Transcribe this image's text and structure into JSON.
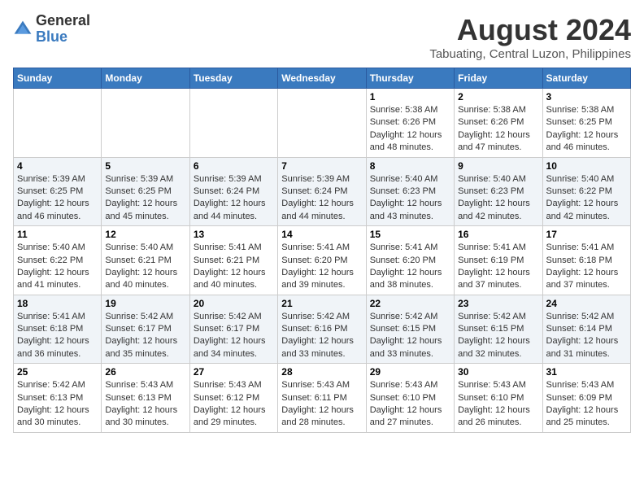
{
  "logo": {
    "general": "General",
    "blue": "Blue"
  },
  "title": {
    "month_year": "August 2024",
    "location": "Tabuating, Central Luzon, Philippines"
  },
  "days_of_week": [
    "Sunday",
    "Monday",
    "Tuesday",
    "Wednesday",
    "Thursday",
    "Friday",
    "Saturday"
  ],
  "weeks": [
    [
      {
        "day": "",
        "info": ""
      },
      {
        "day": "",
        "info": ""
      },
      {
        "day": "",
        "info": ""
      },
      {
        "day": "",
        "info": ""
      },
      {
        "day": "1",
        "info": "Sunrise: 5:38 AM\nSunset: 6:26 PM\nDaylight: 12 hours\nand 48 minutes."
      },
      {
        "day": "2",
        "info": "Sunrise: 5:38 AM\nSunset: 6:26 PM\nDaylight: 12 hours\nand 47 minutes."
      },
      {
        "day": "3",
        "info": "Sunrise: 5:38 AM\nSunset: 6:25 PM\nDaylight: 12 hours\nand 46 minutes."
      }
    ],
    [
      {
        "day": "4",
        "info": "Sunrise: 5:39 AM\nSunset: 6:25 PM\nDaylight: 12 hours\nand 46 minutes."
      },
      {
        "day": "5",
        "info": "Sunrise: 5:39 AM\nSunset: 6:25 PM\nDaylight: 12 hours\nand 45 minutes."
      },
      {
        "day": "6",
        "info": "Sunrise: 5:39 AM\nSunset: 6:24 PM\nDaylight: 12 hours\nand 44 minutes."
      },
      {
        "day": "7",
        "info": "Sunrise: 5:39 AM\nSunset: 6:24 PM\nDaylight: 12 hours\nand 44 minutes."
      },
      {
        "day": "8",
        "info": "Sunrise: 5:40 AM\nSunset: 6:23 PM\nDaylight: 12 hours\nand 43 minutes."
      },
      {
        "day": "9",
        "info": "Sunrise: 5:40 AM\nSunset: 6:23 PM\nDaylight: 12 hours\nand 42 minutes."
      },
      {
        "day": "10",
        "info": "Sunrise: 5:40 AM\nSunset: 6:22 PM\nDaylight: 12 hours\nand 42 minutes."
      }
    ],
    [
      {
        "day": "11",
        "info": "Sunrise: 5:40 AM\nSunset: 6:22 PM\nDaylight: 12 hours\nand 41 minutes."
      },
      {
        "day": "12",
        "info": "Sunrise: 5:40 AM\nSunset: 6:21 PM\nDaylight: 12 hours\nand 40 minutes."
      },
      {
        "day": "13",
        "info": "Sunrise: 5:41 AM\nSunset: 6:21 PM\nDaylight: 12 hours\nand 40 minutes."
      },
      {
        "day": "14",
        "info": "Sunrise: 5:41 AM\nSunset: 6:20 PM\nDaylight: 12 hours\nand 39 minutes."
      },
      {
        "day": "15",
        "info": "Sunrise: 5:41 AM\nSunset: 6:20 PM\nDaylight: 12 hours\nand 38 minutes."
      },
      {
        "day": "16",
        "info": "Sunrise: 5:41 AM\nSunset: 6:19 PM\nDaylight: 12 hours\nand 37 minutes."
      },
      {
        "day": "17",
        "info": "Sunrise: 5:41 AM\nSunset: 6:18 PM\nDaylight: 12 hours\nand 37 minutes."
      }
    ],
    [
      {
        "day": "18",
        "info": "Sunrise: 5:41 AM\nSunset: 6:18 PM\nDaylight: 12 hours\nand 36 minutes."
      },
      {
        "day": "19",
        "info": "Sunrise: 5:42 AM\nSunset: 6:17 PM\nDaylight: 12 hours\nand 35 minutes."
      },
      {
        "day": "20",
        "info": "Sunrise: 5:42 AM\nSunset: 6:17 PM\nDaylight: 12 hours\nand 34 minutes."
      },
      {
        "day": "21",
        "info": "Sunrise: 5:42 AM\nSunset: 6:16 PM\nDaylight: 12 hours\nand 33 minutes."
      },
      {
        "day": "22",
        "info": "Sunrise: 5:42 AM\nSunset: 6:15 PM\nDaylight: 12 hours\nand 33 minutes."
      },
      {
        "day": "23",
        "info": "Sunrise: 5:42 AM\nSunset: 6:15 PM\nDaylight: 12 hours\nand 32 minutes."
      },
      {
        "day": "24",
        "info": "Sunrise: 5:42 AM\nSunset: 6:14 PM\nDaylight: 12 hours\nand 31 minutes."
      }
    ],
    [
      {
        "day": "25",
        "info": "Sunrise: 5:42 AM\nSunset: 6:13 PM\nDaylight: 12 hours\nand 30 minutes."
      },
      {
        "day": "26",
        "info": "Sunrise: 5:43 AM\nSunset: 6:13 PM\nDaylight: 12 hours\nand 30 minutes."
      },
      {
        "day": "27",
        "info": "Sunrise: 5:43 AM\nSunset: 6:12 PM\nDaylight: 12 hours\nand 29 minutes."
      },
      {
        "day": "28",
        "info": "Sunrise: 5:43 AM\nSunset: 6:11 PM\nDaylight: 12 hours\nand 28 minutes."
      },
      {
        "day": "29",
        "info": "Sunrise: 5:43 AM\nSunset: 6:10 PM\nDaylight: 12 hours\nand 27 minutes."
      },
      {
        "day": "30",
        "info": "Sunrise: 5:43 AM\nSunset: 6:10 PM\nDaylight: 12 hours\nand 26 minutes."
      },
      {
        "day": "31",
        "info": "Sunrise: 5:43 AM\nSunset: 6:09 PM\nDaylight: 12 hours\nand 25 minutes."
      }
    ]
  ]
}
